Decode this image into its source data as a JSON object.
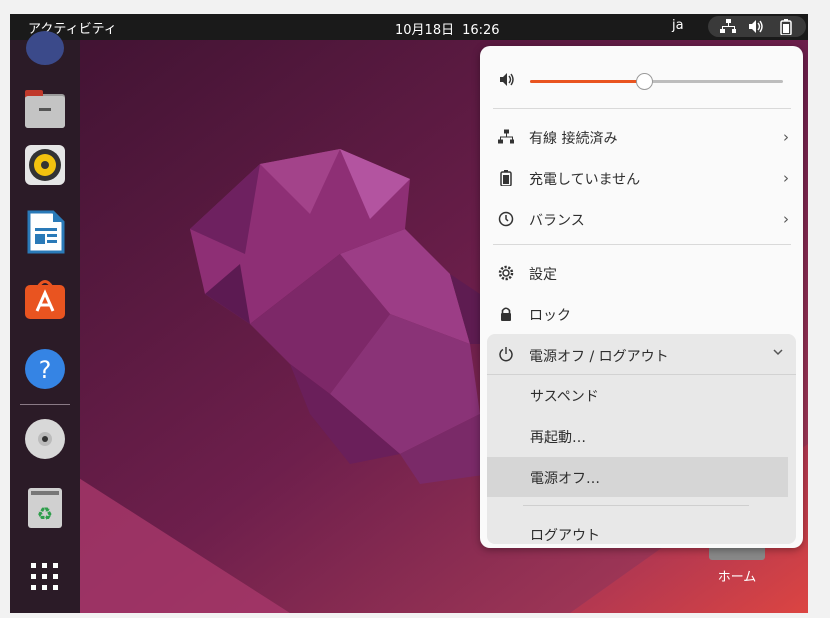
{
  "topbar": {
    "activities": "アクティビティ",
    "date": "10月18日",
    "time": "16:26",
    "input_method": "ja"
  },
  "desktop": {
    "home_label": "ホーム"
  },
  "dock": {
    "items": [
      "files-icon",
      "rhythmbox-icon",
      "libreoffice-writer-icon",
      "app-center-icon",
      "help-icon",
      "optical-disc-icon",
      "trash-icon",
      "show-apps-icon"
    ]
  },
  "menu": {
    "volume_level": 0.45,
    "items": [
      {
        "label": "有線 接続済み",
        "icon": "network-wired-icon"
      },
      {
        "label": "充電していません",
        "icon": "battery-icon"
      },
      {
        "label": "バランス",
        "icon": "power-profile-icon"
      },
      {
        "label": "設定",
        "icon": "settings-gear-icon"
      },
      {
        "label": "ロック",
        "icon": "lock-icon"
      }
    ],
    "power": {
      "label": "電源オフ / ログアウト",
      "options": [
        "サスペンド",
        "再起動…",
        "電源オフ…",
        "ログアウト"
      ]
    }
  },
  "colors": {
    "accent": "#e95420",
    "panel": "#1a1a1a",
    "menu_bg": "#fafafa"
  }
}
